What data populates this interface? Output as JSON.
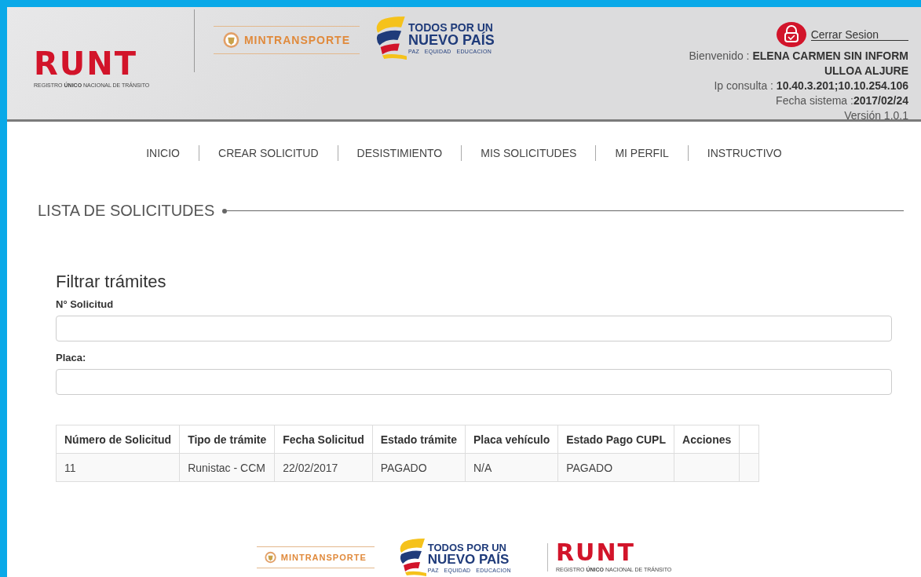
{
  "header": {
    "runt": {
      "title": "RUNT",
      "subtitle": "REGISTRO **ÚNICO** NACIONAL DE TRÁNSITO"
    },
    "ministry": "MINTRANSPORTE",
    "slogan": {
      "line1": "TODOS POR UN",
      "line2": "NUEVO PAÍS",
      "tagline": "PAZ   EQUIDAD   EDUCACION"
    },
    "logout": "Cerrar Sesion",
    "welcome": "Bienvenido : **ELENA CARMEN SIN INFORM ULLOA ALJURE**",
    "ip": "Ip consulta : **10.40.3.201;10.10.254.106**",
    "date": "Fecha sistema :**2017/02/24**",
    "version": "Versión 1.0.1"
  },
  "nav": [
    "INICIO",
    "CREAR SOLICITUD",
    "DESISTIMIENTO",
    "MIS SOLICITUDES",
    "MI PERFIL",
    "INSTRUCTIVO"
  ],
  "section_title": "LISTA DE SOLICITUDES",
  "filter": {
    "title": "Filtrar trámites",
    "fields": [
      {
        "label": "N° Solicitud"
      },
      {
        "label": "Placa:"
      }
    ]
  },
  "table": {
    "columns": [
      "Número de Solicitud",
      "Tipo de trámite",
      "Fecha Solicitud",
      "Estado trámite",
      "Placa vehículo",
      "Estado Pago CUPL",
      "Acciones"
    ],
    "rows": [
      [
        "11",
        "Runistac - CCM",
        "22/02/2017",
        "PAGADO",
        "N/A",
        "PAGADO"
      ]
    ]
  },
  "footer": {
    "ministry": "MINTRANSPORTE",
    "slogan": {
      "line1": "TODOS POR UN",
      "line2": "NUEVO PAÍS",
      "tagline": "PAZ   EQUIDAD   EDUCACION"
    },
    "runt": {
      "title": "RUNT",
      "subtitle": "REGISTRO **ÚNICO** NACIONAL DE TRÁNSITO"
    }
  }
}
